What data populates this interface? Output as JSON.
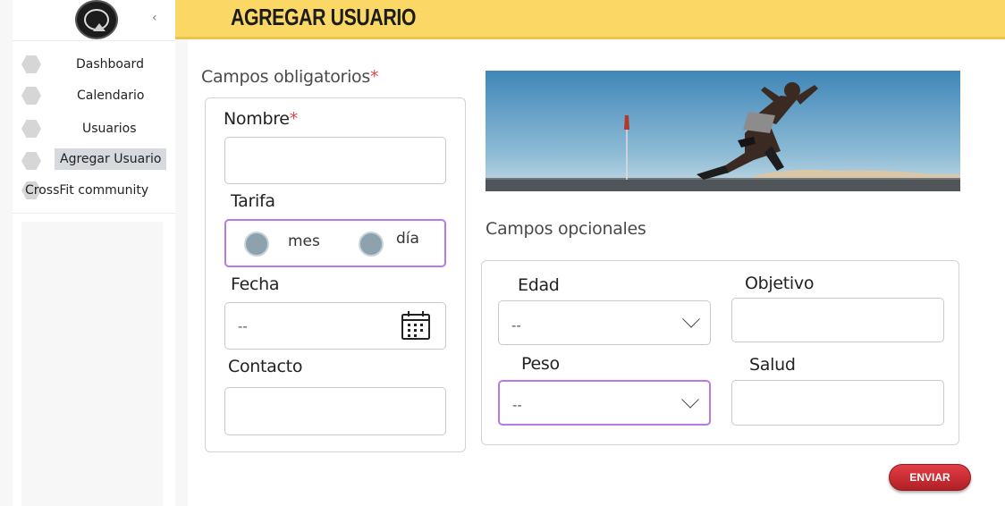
{
  "sidebar": {
    "collapse_glyph": "‹",
    "items": [
      {
        "label": "Dashboard",
        "icon": "hexagon-icon"
      },
      {
        "label": "Calendario",
        "icon": "hexagon-icon"
      },
      {
        "label": "Usuarios",
        "icon": "hexagon-icon"
      },
      {
        "label": "Agregar Usuario",
        "icon": "hexagon-icon",
        "active": true
      },
      {
        "label": "CrossFit community",
        "icon": "hexagon-icon"
      }
    ]
  },
  "header": {
    "title": "AGREGAR USUARIO"
  },
  "required_section": {
    "title": "Campos obligatorios",
    "asterisk": "*",
    "nombre": {
      "label": "Nombre",
      "asterisk": "*",
      "value": ""
    },
    "tarifa": {
      "label": "Tarifa",
      "options": [
        "mes",
        "día"
      ]
    },
    "fecha": {
      "label": "Fecha",
      "value": "--"
    },
    "contacto": {
      "label": "Contacto",
      "value": ""
    }
  },
  "optional_section": {
    "title": "Campos opcionales",
    "edad": {
      "label": "Edad",
      "value": "--"
    },
    "objetivo": {
      "label": "Objetivo",
      "value": ""
    },
    "peso": {
      "label": "Peso",
      "value": "--"
    },
    "salud": {
      "label": "Salud",
      "value": ""
    }
  },
  "submit_label": "ENVIAR",
  "colors": {
    "header_bg": "#fbd866",
    "accent_outline": "#b57be3",
    "required": "#e04646",
    "submit": "#c9252d"
  }
}
